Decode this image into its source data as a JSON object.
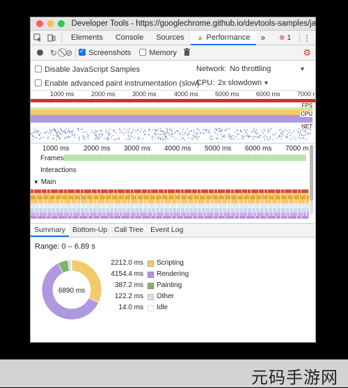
{
  "window": {
    "title": "Developer Tools - https://googlechrome.github.io/devtools-samples/jank/"
  },
  "tabs": [
    {
      "label": "Elements"
    },
    {
      "label": "Console"
    },
    {
      "label": "Sources"
    },
    {
      "label": "Performance",
      "active": true,
      "warning": true
    }
  ],
  "tab_overflow": "»",
  "errors": {
    "count": "1"
  },
  "toolbar": {
    "screenshots_label": "Screenshots",
    "screenshots_checked": true,
    "memory_label": "Memory",
    "memory_checked": false
  },
  "settings": {
    "disable_js_samples_label": "Disable JavaScript Samples",
    "advanced_paint_label": "Enable advanced paint instrumentation (slow)",
    "network_label": "Network:",
    "network_value": "No throttling",
    "cpu_label": "CPU:",
    "cpu_value": "2x slowdown"
  },
  "overview": {
    "ticks": [
      "1000 ms",
      "2000 ms",
      "3000 ms",
      "4000 ms",
      "5000 ms",
      "6000 ms",
      "7000 r"
    ],
    "labels": {
      "fps": "FPS",
      "cpu": "CPU",
      "net": "NET"
    }
  },
  "timeline": {
    "ticks": [
      "1000 ms",
      "2000 ms",
      "3000 ms",
      "4000 ms",
      "5000 ms",
      "6000 ms",
      "7000 m"
    ],
    "tracks": {
      "frames": "Frames",
      "interactions": "Interactions",
      "main": "Main"
    }
  },
  "bottom_tabs": [
    {
      "label": "Summary",
      "active": true
    },
    {
      "label": "Bottom-Up"
    },
    {
      "label": "Call Tree"
    },
    {
      "label": "Event Log"
    }
  ],
  "summary": {
    "range": "Range: 0 – 6.89 s",
    "total": "6890 ms",
    "rows": [
      {
        "value": "2212.0 ms",
        "name": "Scripting",
        "color": "#f2ca6b",
        "ms": 2212.0
      },
      {
        "value": "4154.4 ms",
        "name": "Rendering",
        "color": "#af98e0",
        "ms": 4154.4
      },
      {
        "value": "387.2 ms",
        "name": "Painting",
        "color": "#7cb56b",
        "ms": 387.2
      },
      {
        "value": "122.2 ms",
        "name": "Other",
        "color": "#dedede",
        "ms": 122.2
      },
      {
        "value": "14.0 ms",
        "name": "Idle",
        "color": "#ffffff",
        "ms": 14.0
      }
    ]
  },
  "watermark": "元码手游网",
  "colors": {
    "scripting": "#f2ca6b",
    "rendering": "#af98e0",
    "painting": "#7cb56b",
    "frames": "#bde6b1",
    "fps_red": "#d93025",
    "accent": "#1a73e8"
  }
}
